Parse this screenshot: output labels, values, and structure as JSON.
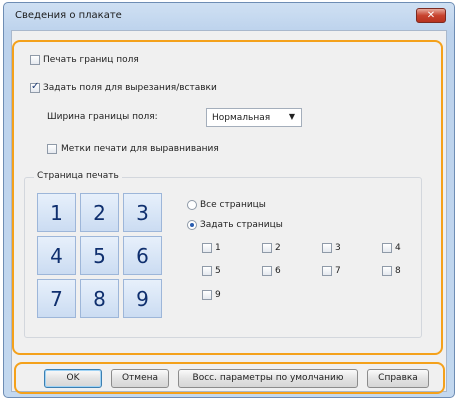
{
  "window": {
    "title": "Сведения о плакате",
    "close_label": "✕"
  },
  "options": {
    "print_borders_label": "Печать границ поля",
    "print_borders_checked": false,
    "cut_paste_label": "Задать поля для вырезания/вставки",
    "cut_paste_checked": true,
    "border_width_label": "Ширина границы поля:",
    "border_width_value": "Нормальная",
    "align_marks_label": "Метки печати для выравнивания",
    "align_marks_checked": false
  },
  "pages": {
    "group_title": "Страница печать",
    "tiles": [
      "1",
      "2",
      "3",
      "4",
      "5",
      "6",
      "7",
      "8",
      "9"
    ],
    "all_pages_label": "Все страницы",
    "specify_pages_label": "Задать страницы",
    "page_checks": [
      "1",
      "2",
      "3",
      "4",
      "5",
      "6",
      "7",
      "8",
      "9"
    ]
  },
  "buttons": {
    "ok": "OK",
    "cancel": "Отмена",
    "restore_defaults": "Восс. параметры по умолчанию",
    "help": "Справка"
  }
}
